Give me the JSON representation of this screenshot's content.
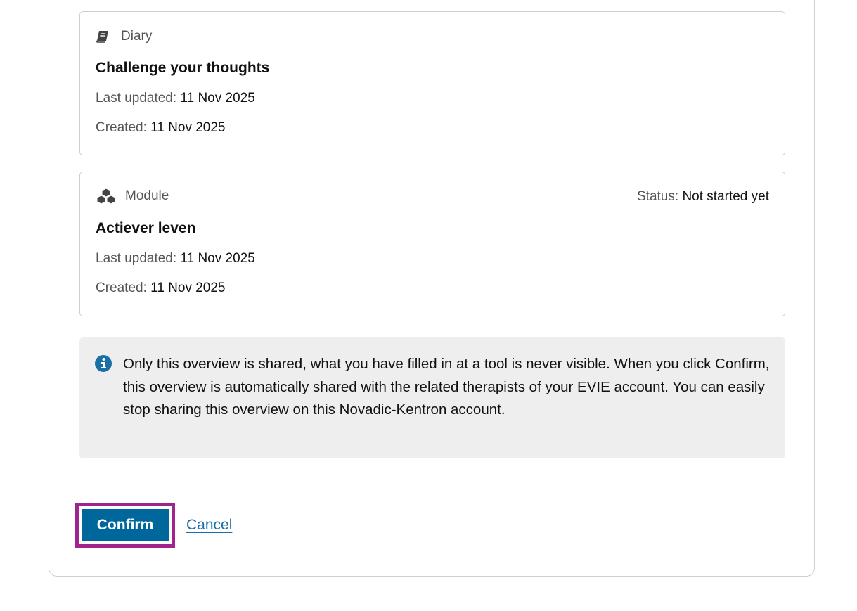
{
  "items": [
    {
      "type_label": "Diary",
      "type_icon": "book-icon",
      "title": "Challenge your thoughts",
      "last_updated_label": "Last updated:",
      "last_updated_value": "11 Nov 2025",
      "created_label": "Created:",
      "created_value": "11 Nov 2025"
    },
    {
      "type_label": "Module",
      "type_icon": "cubes-icon",
      "status_label": "Status:",
      "status_value": "Not started yet",
      "title": "Actiever leven",
      "last_updated_label": "Last updated:",
      "last_updated_value": "11 Nov 2025",
      "created_label": "Created:",
      "created_value": "11 Nov 2025"
    }
  ],
  "info": {
    "icon": "info-circle-icon",
    "text": "Only this overview is shared, what you have filled in at a tool is never visible. When you click Confirm, this overview is automatically shared with the related therapists of your EVIE account. You can easily stop sharing this overview on this Novadic-Kentron account."
  },
  "actions": {
    "confirm_label": "Confirm",
    "cancel_label": "Cancel"
  },
  "colors": {
    "primary": "#00679c",
    "focus_outline": "#a0248e",
    "link": "#1a6fa5",
    "info_icon": "#1a6fa5",
    "info_background": "#eeeeee"
  }
}
